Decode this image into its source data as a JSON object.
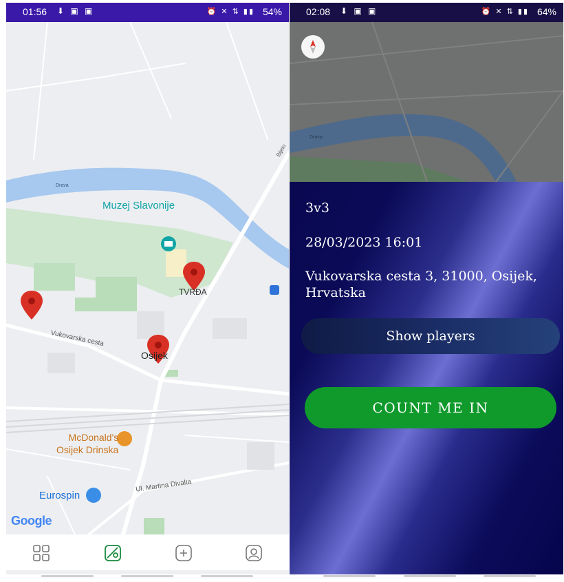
{
  "left_screen": {
    "status": {
      "time": "01:56",
      "battery": "54%"
    },
    "map": {
      "labels": {
        "river": "Drava",
        "museum": "Muzej Slavonije",
        "district": "TVRĐA",
        "street": "Vukovarska cesta",
        "city": "Osijek",
        "mcdonalds": "McDonald's\nOsijek Drinska",
        "eurospin": "Eurospin",
        "martina": "Ul. Martina Divalta",
        "bijelo": "Bijelo"
      },
      "google": "Google"
    },
    "nav": [
      "grid-icon",
      "map-icon",
      "add-icon",
      "profile-icon"
    ],
    "active_nav": "map-icon",
    "accent": "#3a18a8"
  },
  "right_screen": {
    "status": {
      "time": "02:08",
      "battery": "64%"
    },
    "map_label": "Drava",
    "event": {
      "title": "3v3",
      "datetime": "28/03/2023 16:01",
      "address": "Vukovarska cesta 3, 31000, Osijek, Hrvatska",
      "show_players": "Show players",
      "count_me_in": "COUNT ME IN"
    },
    "colors": {
      "card_dark": "#0a0850",
      "button_green": "#0f9a2b"
    }
  }
}
